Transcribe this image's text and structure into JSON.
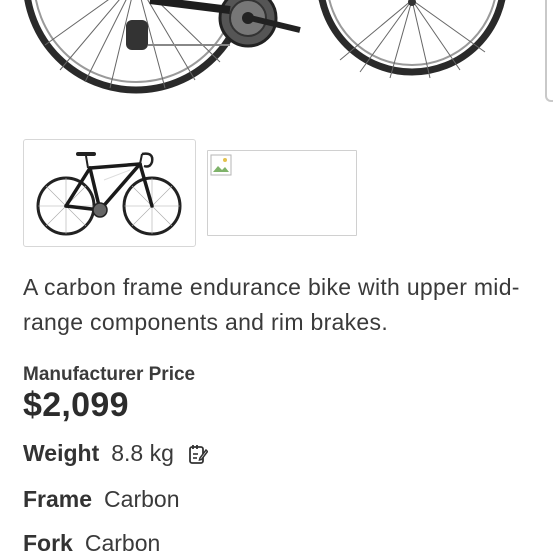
{
  "product": {
    "description": "A carbon frame endurance bike with upper mid-range components and rim brakes.",
    "price_label": "Manufacturer Price",
    "price": "$2,099"
  },
  "gallery": {
    "selected_index": 0,
    "thumbnails": [
      {
        "icon": "bicycle-image"
      },
      {
        "icon": "broken-image-icon"
      }
    ]
  },
  "specs": [
    {
      "key": "Weight",
      "value": "8.8 kg",
      "icon": "edit-icon"
    },
    {
      "key": "Frame",
      "value": "Carbon"
    },
    {
      "key": "Fork",
      "value": "Carbon"
    }
  ]
}
